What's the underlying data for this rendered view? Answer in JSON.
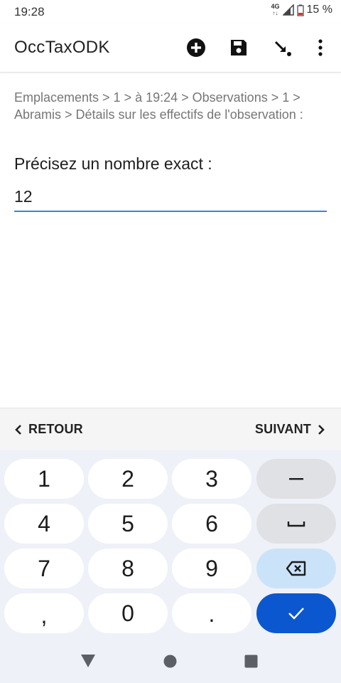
{
  "status_bar": {
    "time": "19:28",
    "network": "4G",
    "battery": "15 %"
  },
  "app_bar": {
    "title": "OccTaxODK",
    "actions": [
      "add-circle-icon",
      "save-icon",
      "goto-icon",
      "more-vertical-icon"
    ]
  },
  "form": {
    "breadcrumb": "Emplacements > 1 > à 19:24 > Observations > 1 > Abramis > Détails sur les effectifs de l'observation :",
    "question": "Précisez un nombre exact :",
    "answer_value": "12"
  },
  "navigation": {
    "back_label": "RETOUR",
    "next_label": "SUIVANT"
  },
  "keyboard": {
    "keys": [
      "1",
      "2",
      "3",
      "4",
      "5",
      "6",
      "7",
      "8",
      "9",
      ",",
      "0",
      "."
    ],
    "special_keys": [
      "minus-icon",
      "space-icon",
      "backspace-icon",
      "enter-check-icon"
    ]
  },
  "system_nav": [
    "back-triangle-icon",
    "home-circle-icon",
    "recents-square-icon"
  ],
  "colors": {
    "accent": "#3a86d0",
    "enter_key": "#0b57d0",
    "backspace_key": "#cbe3f8",
    "keyboard_bg": "#eef1f8"
  }
}
